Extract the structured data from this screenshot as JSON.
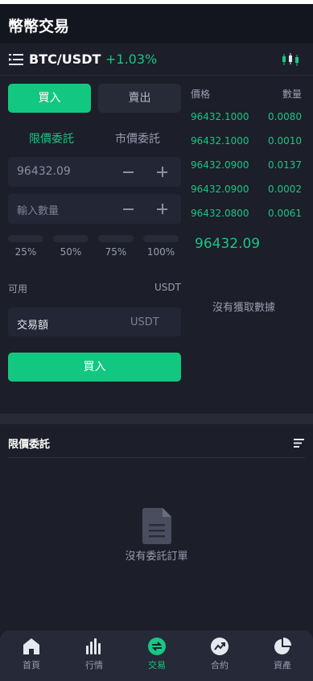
{
  "header": {
    "title": "幣幣交易"
  },
  "pair": {
    "symbol": "BTC/USDT",
    "change": "+1.03%"
  },
  "trade_form": {
    "buy_tab": "買入",
    "sell_tab": "賣出",
    "order_types": [
      "限價委託",
      "市價委託"
    ],
    "price_value": "96432.09",
    "qty_placeholder": "輸入數量",
    "percents": [
      "25%",
      "50%",
      "75%",
      "100%"
    ],
    "available_label": "可用",
    "available_unit": "USDT",
    "amount_label": "交易額",
    "amount_unit": "USDT",
    "submit_label": "買入"
  },
  "orderbook": {
    "price_header": "價格",
    "qty_header": "數量",
    "rows": [
      {
        "price": "96432.1000",
        "qty": "0.0080"
      },
      {
        "price": "96432.1000",
        "qty": "0.0010"
      },
      {
        "price": "96432.0900",
        "qty": "0.0137"
      },
      {
        "price": "96432.0900",
        "qty": "0.0002"
      },
      {
        "price": "96432.0800",
        "qty": "0.0061"
      }
    ],
    "last_price": "96432.09",
    "no_data": "沒有獲取數據"
  },
  "pending_orders": {
    "title": "限價委託",
    "empty_text": "沒有委託訂單"
  },
  "tabbar": {
    "items": [
      {
        "label": "首頁",
        "icon": "home-icon"
      },
      {
        "label": "行情",
        "icon": "chart-bars-icon"
      },
      {
        "label": "交易",
        "icon": "trade-icon"
      },
      {
        "label": "合約",
        "icon": "trend-icon"
      },
      {
        "label": "資產",
        "icon": "pie-chart-icon"
      }
    ],
    "active": "交易"
  },
  "colors": {
    "accent_green": "#17c784",
    "button_green": "#12c880",
    "background": "#1c1e29"
  }
}
